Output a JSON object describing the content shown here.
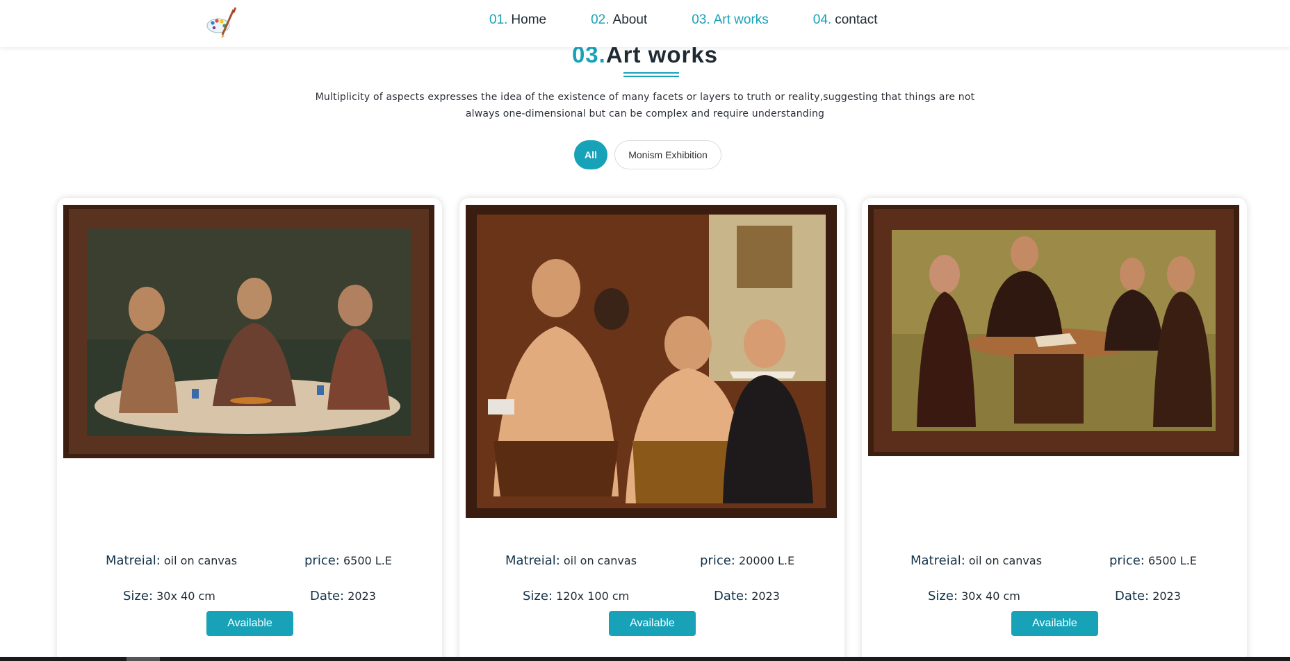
{
  "nav": {
    "items": [
      {
        "num": "01.",
        "label": "Home"
      },
      {
        "num": "02.",
        "label": "About"
      },
      {
        "num": "03.",
        "label": "Art works"
      },
      {
        "num": "04.",
        "label": "contact"
      }
    ],
    "active_index": 2,
    "logo_icon": "palette-brush-logo"
  },
  "section": {
    "num": "03.",
    "title": "Art works",
    "description": "Multiplicity of aspects expresses the idea of the existence of many facets or layers to truth or reality,suggesting that things are not always one-dimensional but can be complex and require understanding"
  },
  "filters": [
    "All",
    "Monism Exhibition"
  ],
  "labels": {
    "material": "Matreial:",
    "price": "price:",
    "size": "Size:",
    "date": "Date:",
    "button": "Available"
  },
  "artworks": [
    {
      "material": "oil on canvas",
      "price": "6500 L.E",
      "size": "30x 40 cm",
      "date": "2023"
    },
    {
      "material": "oil on canvas",
      "price": "20000 L.E",
      "size": "120x 100 cm",
      "date": "2023"
    },
    {
      "material": "oil on canvas",
      "price": "6500 L.E",
      "size": "30x 40 cm",
      "date": "2023"
    }
  ],
  "colors": {
    "accent": "#17a2b8",
    "text": "#1f2a33",
    "frame": "#4a2514"
  }
}
